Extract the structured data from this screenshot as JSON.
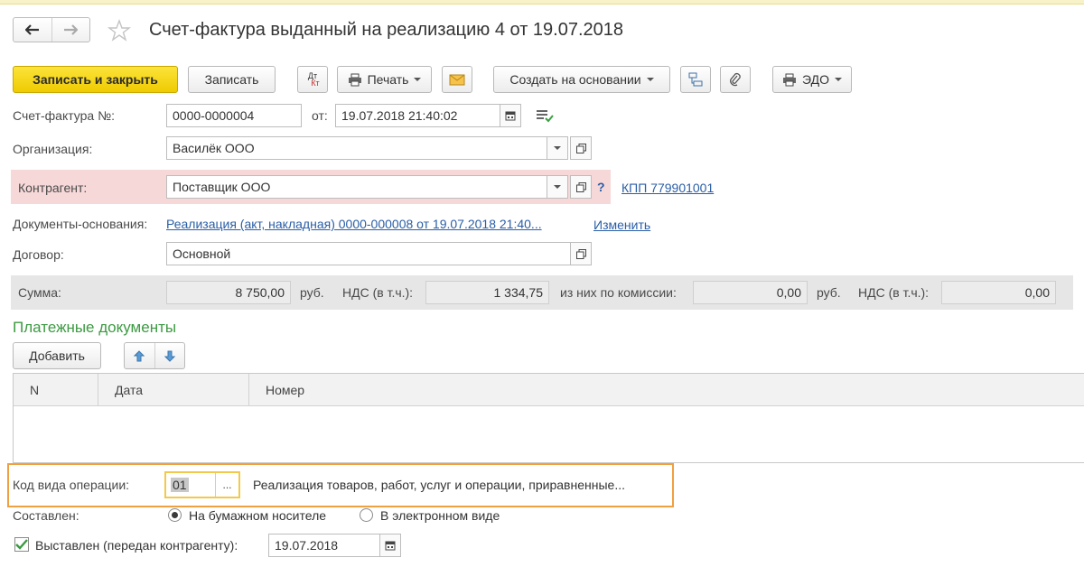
{
  "window": {
    "title": "Счет-фактура выданный на реализацию 4 от 19.07.2018"
  },
  "toolbar": {
    "save_close": "Записать и закрыть",
    "save": "Записать",
    "dt_kt_top": "Дт",
    "dt_kt_bottom": "Кт",
    "print": "Печать",
    "create_basis": "Создать на основании",
    "edo": "ЭДО"
  },
  "form": {
    "invoice_label": "Счет-фактура №:",
    "invoice_number": "0000-0000004",
    "from_label": "от:",
    "invoice_date": "19.07.2018 21:40:02",
    "org_label": "Организация:",
    "org_value": "Василёк ООО",
    "contractor_label": "Контрагент:",
    "contractor_value": "Поставщик ООО",
    "help": "?",
    "kpp_link": "КПП 779901001",
    "basis_label": "Документы-основания:",
    "basis_link": "Реализация (акт, накладная) 0000-000008 от 19.07.2018 21:40...",
    "change_link": "Изменить",
    "contract_label": "Договор:",
    "contract_value": "Основной"
  },
  "summary": {
    "sum_label": "Сумма:",
    "sum_value": "8 750,00",
    "currency1": "руб.",
    "vat_label1": "НДС (в т.ч.):",
    "vat_value1": "1 334,75",
    "commission_label": "из них по комиссии:",
    "commission_value": "0,00",
    "currency2": "руб.",
    "vat_label2": "НДС (в т.ч.):",
    "vat_value2": "0,00"
  },
  "payments": {
    "title": "Платежные документы",
    "add_button": "Добавить",
    "columns": [
      "N",
      "Дата",
      "Номер"
    ]
  },
  "operation": {
    "label": "Код вида операции:",
    "code": "01",
    "dots": "...",
    "description": "Реализация товаров, работ, услуг и операции, приравненные..."
  },
  "composed": {
    "label": "Составлен:",
    "option_paper": "На бумажном носителе",
    "option_electronic": "В электронном виде",
    "selected": "На бумажном носителе"
  },
  "issued": {
    "checked": true,
    "label": "Выставлен (передан контрагенту):",
    "date": "19.07.2018"
  }
}
